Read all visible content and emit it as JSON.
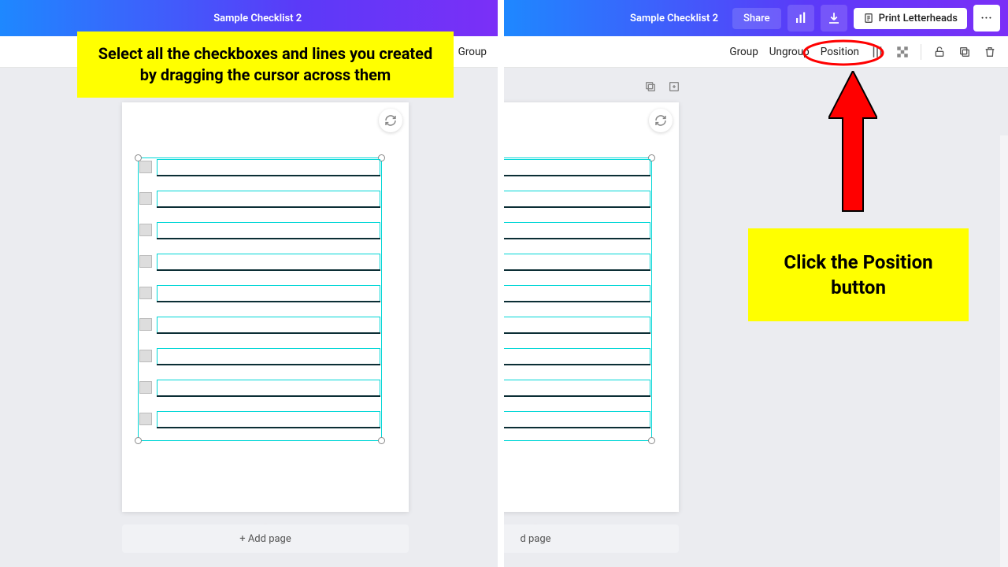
{
  "left": {
    "doc_title": "Sample Checklist 2",
    "context": {
      "group": "Group"
    },
    "add_page": "+ Add page"
  },
  "right": {
    "doc_title": "Sample Checklist 2",
    "share": "Share",
    "print": "Print Letterheads",
    "context": {
      "group": "Group",
      "ungroup": "Ungroup",
      "position": "Position"
    },
    "add_page": "d page"
  },
  "callouts": {
    "select_all": "Select all the checkboxes and lines you created by dragging the cursor across them",
    "click_position": "Click the Position button"
  },
  "colors": {
    "accent": "#7b2ff7",
    "selection": "#00d6d6",
    "highlight": "#ffff00",
    "arrow": "#ff0000"
  },
  "checklist_rows": 9
}
